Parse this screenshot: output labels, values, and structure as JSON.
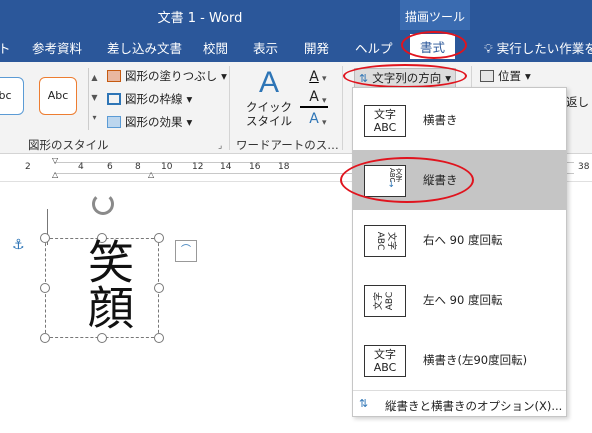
{
  "title": "文書 1  -  Word",
  "contextual_group": "描画ツール",
  "tabs": [
    "ト",
    "参考資料",
    "差し込み文書",
    "校閲",
    "表示",
    "開発",
    "ヘルプ"
  ],
  "active_tab": "書式",
  "tellme": "実行したい作業を",
  "ribbon": {
    "style_boxes": [
      "bc",
      "Abc"
    ],
    "shape_fill": "図形の塗りつぶし",
    "shape_outline": "図形の枠線",
    "shape_effects": "図形の効果",
    "shape_styles_label": "図形のスタイル",
    "quick_style": [
      "クイック",
      "スタイル"
    ],
    "wordart_label": "ワードアートのス…",
    "text_direction": "文字列の方向",
    "position": "位置",
    "wrap": "返し"
  },
  "ruler_numbers": [
    "2",
    "2",
    "4",
    "6",
    "8",
    "10",
    "12",
    "14",
    "16",
    "18",
    "38"
  ],
  "textbox_text": "笑顔",
  "menu": {
    "items": [
      {
        "label": "横書き",
        "icon": "horizontal-text-icon",
        "icon_text": "文字ABC"
      },
      {
        "label": "縦書き",
        "icon": "vertical-text-icon",
        "icon_text": "縦書き"
      },
      {
        "label": "右へ 90 度回転",
        "icon": "rotate-right-90-icon",
        "icon_text": "文字ABC"
      },
      {
        "label": "左へ 90 度回転",
        "icon": "rotate-left-90-icon",
        "icon_text": "文字ABC"
      },
      {
        "label": "横書き(左90度回転)",
        "icon": "horizontal-rotate-left-icon",
        "icon_text": "文字ABC"
      }
    ],
    "options": "縦書きと横書きのオプション(X)..."
  },
  "colors": {
    "word_blue": "#2b579a",
    "highlight_circle": "#e0141e",
    "selected_item": "#c5c5c5"
  }
}
